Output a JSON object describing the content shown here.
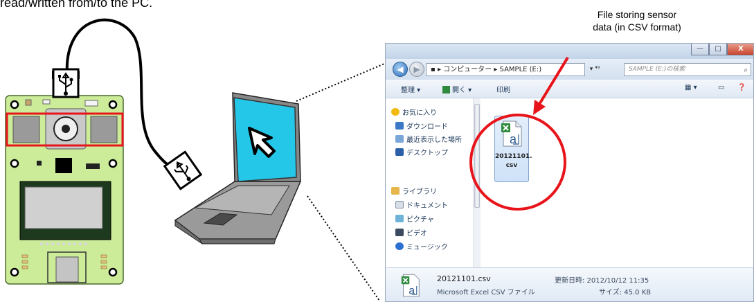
{
  "intro_text_fragment": "read/written from/to the PC.",
  "callout": {
    "line1": "File storing sensor",
    "line2": "data (in CSV format)",
    "arrow_color": "#e8141b"
  },
  "highlight_color": "#e8141b",
  "explorer": {
    "window_buttons": {
      "minimize": "—",
      "maximize": "□",
      "close": "X"
    },
    "address": {
      "path_segments": [
        "コンピューター",
        "SAMPLE (E:)"
      ],
      "path_text": "▪ ▸ コンピューター ▸ SAMPLE (E:)",
      "search_placeholder": "SAMPLE (E:)の検索"
    },
    "toolbar": {
      "organize": "整理 ▾",
      "open": "開く ▾",
      "print": "印刷"
    },
    "sidebar": {
      "favorites": "お気に入り",
      "downloads": "ダウンロード",
      "recent": "最近表示した場所",
      "desktop": "デスクトップ",
      "libraries": "ライブラリ",
      "documents": "ドキュメント",
      "pictures": "ピクチャ",
      "videos": "ビデオ",
      "music": "ミュージック"
    },
    "file": {
      "name_line1": "20121101.",
      "name_line2": "csv"
    },
    "status": {
      "filename": "20121101.csv",
      "type": "Microsoft Excel CSV ファイル",
      "modified": "更新日時: 2012/10/12 11:35",
      "size": "サイズ: 45.0 KB"
    }
  },
  "icons": {
    "board": "sensor-board",
    "usb": "usb-symbol-icon",
    "laptop": "laptop-icon",
    "cursor": "mouse-cursor-icon",
    "excel": "excel-csv-file-icon"
  }
}
